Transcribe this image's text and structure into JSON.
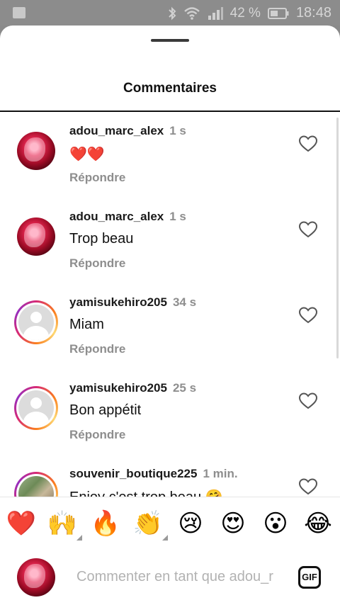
{
  "status_bar": {
    "battery_percent": "42 %",
    "time": "18:48",
    "icons": [
      "image-icon",
      "bluetooth-icon",
      "wifi-icon",
      "signal-icon",
      "battery-icon"
    ]
  },
  "sheet": {
    "title": "Commentaires"
  },
  "comments": [
    {
      "username": "adou_marc_alex",
      "time": "1 s",
      "text": "❤️❤️",
      "reply_label": "Répondre",
      "avatar": "red-profile-avatar"
    },
    {
      "username": "adou_marc_alex",
      "time": "1 s",
      "text": "Trop beau",
      "reply_label": "Répondre",
      "avatar": "red-profile-avatar"
    },
    {
      "username": "yamisukehiro205",
      "time": "34 s",
      "text": "Miam",
      "reply_label": "Répondre",
      "avatar": "default-avatar-story-ring"
    },
    {
      "username": "yamisukehiro205",
      "time": "25 s",
      "text": "Bon appétit",
      "reply_label": "Répondre",
      "avatar": "default-avatar-story-ring"
    },
    {
      "username": "souvenir_boutique225",
      "time": "1 min.",
      "text": "Enjoy c'est trop beau 🤗",
      "reply_label": "",
      "avatar": "photo-avatar-story-ring"
    }
  ],
  "emoji_bar": [
    "❤️",
    "🙌",
    "🔥",
    "👏",
    "😢",
    "😍",
    "😮",
    "😂"
  ],
  "composer": {
    "placeholder": "Commenter en tant que adou_r",
    "gif_label": "GIF"
  },
  "colors": {
    "heart_red": "#ed1c3a",
    "muted_text": "#8e8e8e",
    "story_ring": "#d62976"
  }
}
